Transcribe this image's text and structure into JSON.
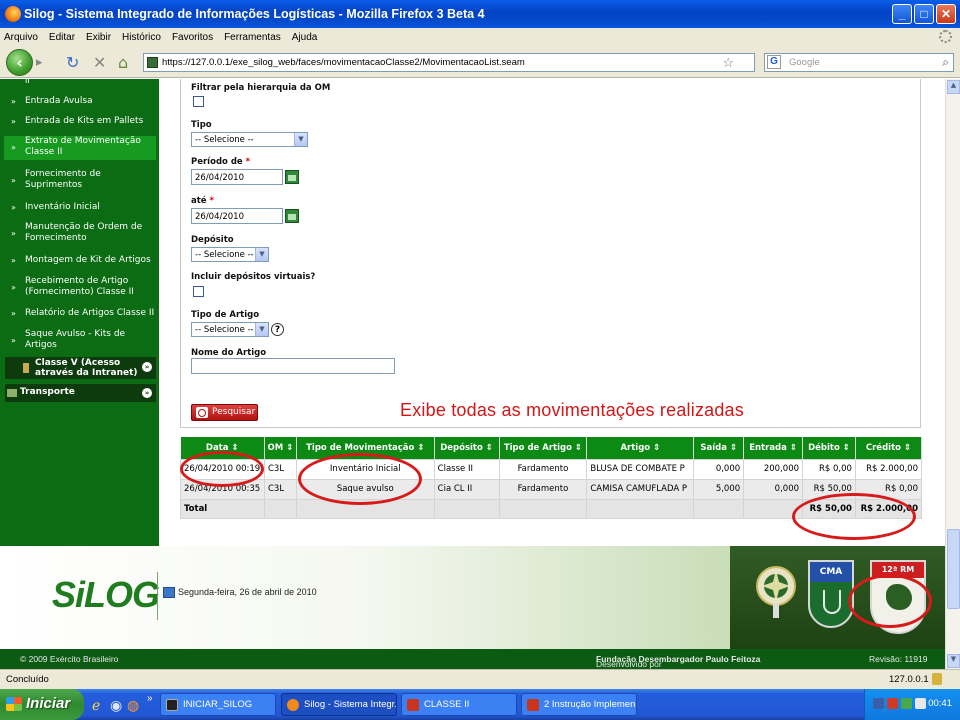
{
  "browser": {
    "title": "Silog - Sistema Integrado de Informações Logísticas - Mozilla Firefox 3 Beta 4",
    "menu": [
      "Arquivo",
      "Editar",
      "Exibir",
      "Histórico",
      "Favoritos",
      "Ferramentas",
      "Ajuda"
    ],
    "url": "https://127.0.0.1/exe_silog_web/faces/movimentacaoClasse2/MovimentacaoList.seam",
    "search_placeholder": "Google",
    "status_left": "Concluído",
    "status_right": "127.0.0.1"
  },
  "sidebar": {
    "items": [
      {
        "label": "Entrada Avulsa"
      },
      {
        "label": "Entrada de Kits em Pallets"
      },
      {
        "label": "Extrato de Movimentação Classe II"
      },
      {
        "label": "Fornecimento de Suprimentos"
      },
      {
        "label": "Inventário Inicial"
      },
      {
        "label": "Manutenção de Ordem de Fornecimento"
      },
      {
        "label": "Montagem de Kit de Artigos"
      },
      {
        "label": "Recebimento de Artigo (Fornecimento) Classe II"
      },
      {
        "label": "Relatório de Artigos Classe II"
      },
      {
        "label": "Saque Avulso - Kits de Artigos"
      }
    ],
    "group_classe5": "Classe V (Acesso através da Intranet)",
    "group_transporte": "Transporte"
  },
  "form": {
    "filtrar_label": "Filtrar pela hierarquia da OM",
    "tipo_label": "Tipo",
    "tipo_value": "-- Selecione --",
    "periodo_label": "Período de",
    "periodo_value": "26/04/2010",
    "ate_label": "até",
    "ate_value": "26/04/2010",
    "deposito_label": "Depósito",
    "deposito_value": "-- Selecione --",
    "virtuais_label": "Incluir depósitos virtuais?",
    "tipo_artigo_label": "Tipo de Artigo",
    "tipo_artigo_value": "-- Selecione --",
    "nome_artigo_label": "Nome do Artigo",
    "nome_artigo_value": "",
    "required_mark": "*",
    "pesquisar_label": "Pesquisar",
    "help_glyph": "?"
  },
  "annotation": "Exibe todas as movimentações realizadas",
  "table": {
    "headers": [
      "Data",
      "OM",
      "Tipo de Movimentação",
      "Depósito",
      "Tipo de Artigo",
      "Artigo",
      "Saída",
      "Entrada",
      "Débito",
      "Crédito"
    ],
    "rows": [
      [
        "26/04/2010 00:19",
        "C3L",
        "Inventário Inicial",
        "Classe II",
        "Fardamento",
        "BLUSA DE COMBATE P",
        "0,000",
        "200,000",
        "R$ 0,00",
        "R$ 2.000,00"
      ],
      [
        "26/04/2010 00:35",
        "C3L",
        "Saque avulso",
        "Cia CL II",
        "Fardamento",
        "CAMISA CAMUFLADA P",
        "5,000",
        "0,000",
        "R$ 50,00",
        "R$ 0,00"
      ]
    ],
    "total_label": "Total",
    "total_debito": "R$ 50,00",
    "total_credito": "R$ 2.000,00"
  },
  "footer": {
    "logo": "SiLOG",
    "date": "Segunda-feira, 26 de abril de 2010",
    "shield_cma": "CMA",
    "shield_rm": "12ª RM",
    "copyright": "© 2009 Exército Brasileiro",
    "developed_prefix": "Desenvolvido por",
    "developed_by": "Fundação Desembargador Paulo Feitoza",
    "revision": "Revisão: 11919"
  },
  "taskbar": {
    "start_label": "Iniciar",
    "tasks": [
      "INICIAR_SILOG",
      "Silog - Sistema Integr...",
      "CLASSE II",
      "2 Instrução Implemen..."
    ],
    "clock": "00:41"
  },
  "colors": {
    "brand_green": "#0b6c13",
    "annotation_red": "#d41616"
  }
}
